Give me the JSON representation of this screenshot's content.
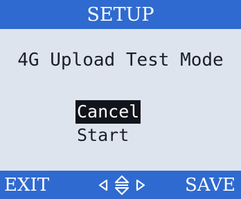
{
  "header": {
    "title": "SETUP"
  },
  "main": {
    "mode_title": "4G Upload Test Mode",
    "options": [
      {
        "label": "Cancel",
        "selected": true
      },
      {
        "label": "Start",
        "selected": false
      }
    ]
  },
  "footer": {
    "left_key": "EXIT",
    "right_key": "SAVE",
    "nav_icon": "navigation-arrows-icon"
  },
  "colors": {
    "bar_blue": "#2f6ad0",
    "screen_bg": "#dde4ee",
    "text_dark": "#1a1f28",
    "selection_bg": "#11151b"
  }
}
